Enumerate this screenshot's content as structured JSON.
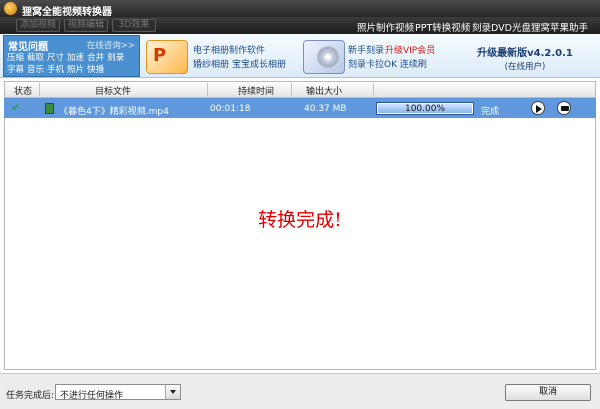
{
  "window": {
    "title": "狸窝全能视频转换器"
  },
  "toolbar": {
    "buttons": [
      "添加视频",
      "视频编辑",
      "3D效果"
    ],
    "links": [
      "照片制作视频",
      "PPT转换视频",
      "刻录DVD光盘",
      "狸窝苹果助手"
    ]
  },
  "faq": {
    "title": "常见问题",
    "consult": "在线咨询>>",
    "tags": [
      "压缩",
      "截取",
      "尺寸",
      "加速",
      "合并",
      "刻录",
      "字幕",
      "音乐",
      "手机",
      "照片",
      "快播"
    ]
  },
  "promo": {
    "album_line1": "电子相册制作软件",
    "album_line2a": "婚纱相册",
    "album_line2b": "宝宝成长相册",
    "burn_a": "新手刻录",
    "burn_vip": "升级VIP会员",
    "burn_line2": "刻录卡拉OK 连续刷",
    "version_title": "升级最新版v4.2.0.1",
    "version_sub": "(在线用户)"
  },
  "table": {
    "headers": [
      "状态",
      "目标文件",
      "持续时间",
      "输出大小"
    ],
    "rows": [
      {
        "file": "《暮色4下》精彩视频.mp4",
        "duration": "00:01:18",
        "size": "40.37 MB",
        "progress_text": "100.00%",
        "progress": 1.0,
        "status": "完成"
      }
    ]
  },
  "message": "转换完成!",
  "bottom": {
    "after_label": "任务完成后:",
    "after_value": "不进行任何操作",
    "cancel_label": "取消"
  },
  "colors": {
    "selection": "#5f98dc",
    "message": "#e00000",
    "faq_bg": "#4a8fd0"
  }
}
